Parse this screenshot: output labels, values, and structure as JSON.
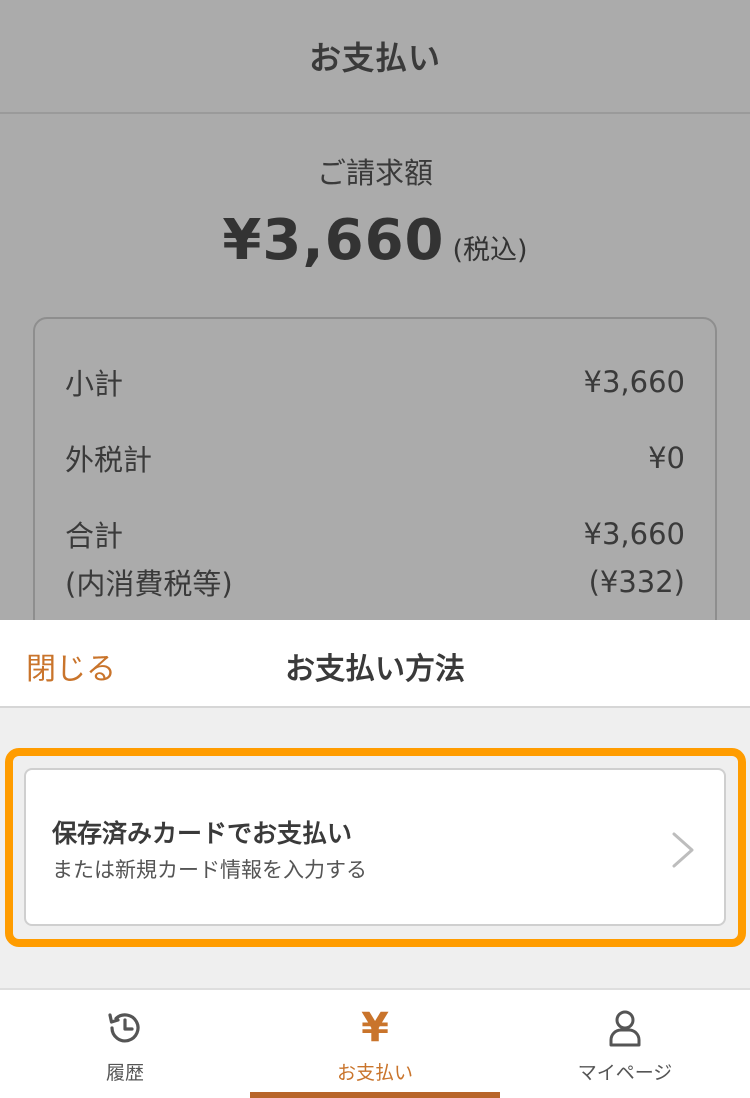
{
  "background_screen": {
    "header_title": "お支払い",
    "bill_label": "ご請求額",
    "bill_amount": "¥3,660",
    "bill_tax_note": "(税込)",
    "summary": {
      "subtotal_label": "小計",
      "subtotal_value": "¥3,660",
      "external_tax_label": "外税計",
      "external_tax_value": "¥0",
      "total_label": "合計",
      "total_value": "¥3,660",
      "internal_tax_label": "(内消費税等)",
      "internal_tax_value": "(¥332)"
    }
  },
  "sheet": {
    "close_label": "閉じる",
    "title": "お支払い方法",
    "option": {
      "title": "保存済みカードでお支払い",
      "subtitle": "または新規カード情報を入力する"
    }
  },
  "tabbar": {
    "tabs": [
      {
        "label": "履歴",
        "icon": "history-icon"
      },
      {
        "label": "お支払い",
        "icon": "yen-icon",
        "active": true
      },
      {
        "label": "マイページ",
        "icon": "person-icon"
      }
    ],
    "yen_icon_glyph": "¥"
  },
  "colors": {
    "accent": "#c9742b",
    "highlight": "#ff9c00",
    "overlay_gray": "#ababab"
  }
}
